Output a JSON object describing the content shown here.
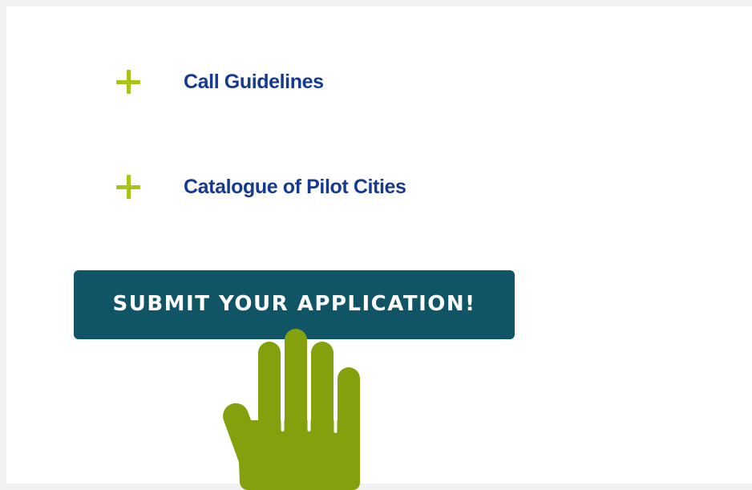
{
  "accordion": {
    "items": [
      {
        "label": "Call Guidelines",
        "icon": "plus-icon"
      },
      {
        "label": "Catalogue of Pilot Cities",
        "icon": "plus-icon"
      }
    ]
  },
  "cta": {
    "label": "SUBMIT YOUR APPLICATION!",
    "icon": "hand-pointer-icon"
  },
  "colors": {
    "page_background": "#f1f1f1",
    "panel_background": "#ffffff",
    "link": "#173a91",
    "plus": "#a6c516",
    "button_background": "#0f5566",
    "button_text": "#ffffff",
    "hand": "#85a00d"
  }
}
